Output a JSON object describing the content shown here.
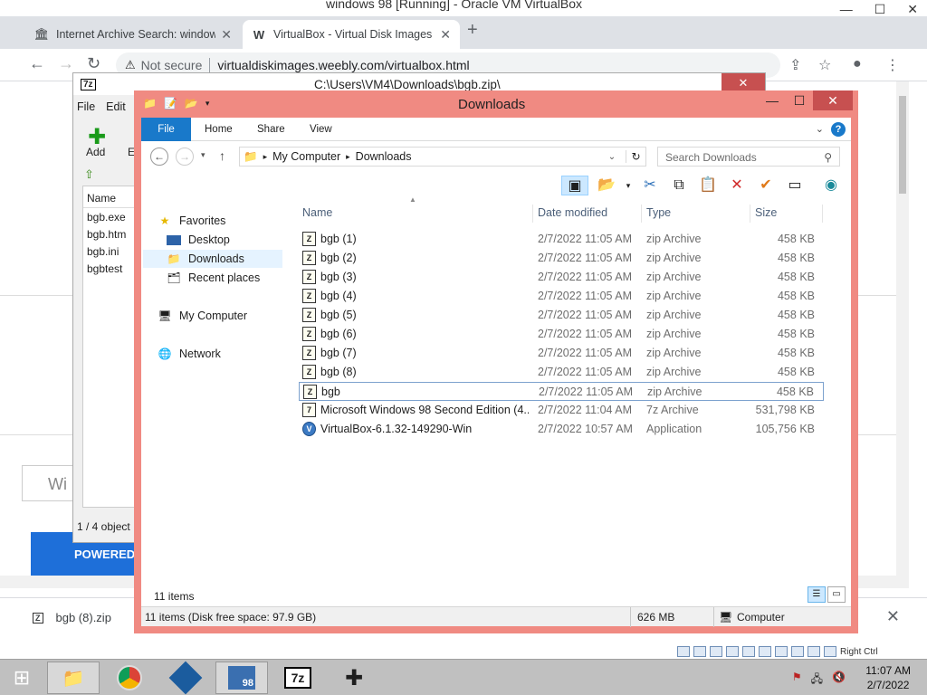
{
  "host": {
    "title": "windows 98 [Running] - Oracle VM VirtualBox",
    "right_ctrl": "Right Ctrl"
  },
  "chrome": {
    "tabs": [
      {
        "label": "Internet Archive Search: windows",
        "icon": "archive-icon"
      },
      {
        "label": "VirtualBox - Virtual Disk Images",
        "icon": "weebly-icon"
      }
    ],
    "not_secure": "Not secure",
    "url": "virtualdiskimages.weebly.com/virtualbox.html",
    "page_box_text": "Wi",
    "powered_text": "POWERED",
    "download_file": "bgb (8).zip"
  },
  "zip": {
    "title": "C:\\Users\\VM4\\Downloads\\bgb.zip\\",
    "menu": [
      "File",
      "Edit"
    ],
    "tools": [
      "Add",
      "Extr"
    ],
    "list_header": "Name",
    "files": [
      "bgb.exe",
      "bgb.htm",
      "bgb.ini",
      "bgbtest"
    ],
    "status": "1 / 4 object"
  },
  "explorer": {
    "title": "Downloads",
    "ribbon_tabs": [
      "File",
      "Home",
      "Share",
      "View"
    ],
    "breadcrumb": [
      "My Computer",
      "Downloads"
    ],
    "search_placeholder": "Search Downloads",
    "nav": {
      "favorites": "Favorites",
      "desktop": "Desktop",
      "downloads": "Downloads",
      "recent": "Recent places",
      "computer": "My Computer",
      "network": "Network"
    },
    "columns": {
      "name": "Name",
      "date": "Date modified",
      "type": "Type",
      "size": "Size"
    },
    "files": [
      {
        "name": "bgb (1)",
        "date": "2/7/2022 11:05 AM",
        "type": "zip Archive",
        "size": "458 KB"
      },
      {
        "name": "bgb (2)",
        "date": "2/7/2022 11:05 AM",
        "type": "zip Archive",
        "size": "458 KB"
      },
      {
        "name": "bgb (3)",
        "date": "2/7/2022 11:05 AM",
        "type": "zip Archive",
        "size": "458 KB"
      },
      {
        "name": "bgb (4)",
        "date": "2/7/2022 11:05 AM",
        "type": "zip Archive",
        "size": "458 KB"
      },
      {
        "name": "bgb (5)",
        "date": "2/7/2022 11:05 AM",
        "type": "zip Archive",
        "size": "458 KB"
      },
      {
        "name": "bgb (6)",
        "date": "2/7/2022 11:05 AM",
        "type": "zip Archive",
        "size": "458 KB"
      },
      {
        "name": "bgb (7)",
        "date": "2/7/2022 11:05 AM",
        "type": "zip Archive",
        "size": "458 KB"
      },
      {
        "name": "bgb (8)",
        "date": "2/7/2022 11:05 AM",
        "type": "zip Archive",
        "size": "458 KB"
      },
      {
        "name": "bgb",
        "date": "2/7/2022 11:05 AM",
        "type": "zip Archive",
        "size": "458 KB"
      },
      {
        "name": "Microsoft Windows 98 Second Edition (4....",
        "date": "2/7/2022 11:04 AM",
        "type": "7z Archive",
        "size": "531,798 KB"
      },
      {
        "name": "VirtualBox-6.1.32-149290-Win",
        "date": "2/7/2022 10:57 AM",
        "type": "Application",
        "size": "105,756 KB"
      }
    ],
    "item_count": "11 items",
    "status_detail": "11 items (Disk free space: 97.9 GB)",
    "status_size": "626 MB",
    "status_location": "Computer"
  },
  "taskbar": {
    "time": "11:07 AM",
    "date": "2/7/2022",
    "apps": [
      "file-manager-icon",
      "chrome-icon",
      "virtualbox-icon",
      "windows98-icon",
      "7zip-icon",
      "gamepad-icon"
    ],
    "app_label_98": "98",
    "app_label_7z": "7z"
  },
  "colors": {
    "explorer_frame": "#f08a82",
    "ribbon_file": "#1979ca",
    "close_red": "#c75050"
  }
}
